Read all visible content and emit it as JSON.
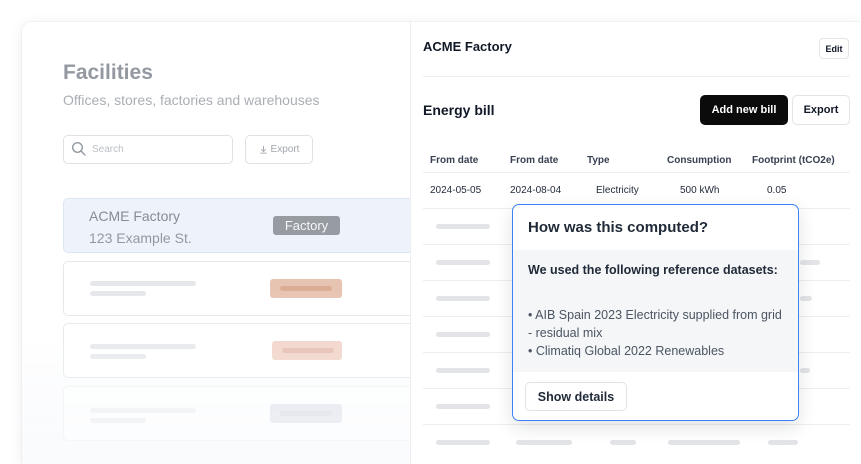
{
  "facilities": {
    "title": "Facilities",
    "subtitle": "Offices, stores, factories and warehouses",
    "search_placeholder": "Search",
    "export_label": "Export",
    "selected": {
      "name": "ACME Factory",
      "address": "123 Example St.",
      "badge": "Factory"
    },
    "placeholder_badge_colors": [
      "#e6c0ab",
      "#efcdc0",
      "#d7dbe6"
    ]
  },
  "detail": {
    "title": "ACME Factory",
    "edit_label": "Edit",
    "section_title": "Energy bill",
    "add_bill_label": "Add new bill",
    "export_label": "Export",
    "columns": [
      "From date",
      "From date",
      "Type",
      "Consumption",
      "Footprint (tCO2e)"
    ],
    "rows": [
      [
        "2024-05-05",
        "2024-08-04",
        "Electricity",
        "500 kWh",
        "0.05"
      ]
    ]
  },
  "popover": {
    "title": "How was this computed?",
    "heading": "We used the following reference datasets:",
    "datasets": [
      "• AIB Spain 2023 Electricity supplied from grid - residual mix",
      "• Climatiq Global 2022 Renewables"
    ],
    "button_label": "Show details"
  },
  "colors": {
    "accent": "#3b82f6",
    "primary_button": "#0b0b0c",
    "badge": "#8f939b",
    "selected_card": "#edf3fb"
  }
}
